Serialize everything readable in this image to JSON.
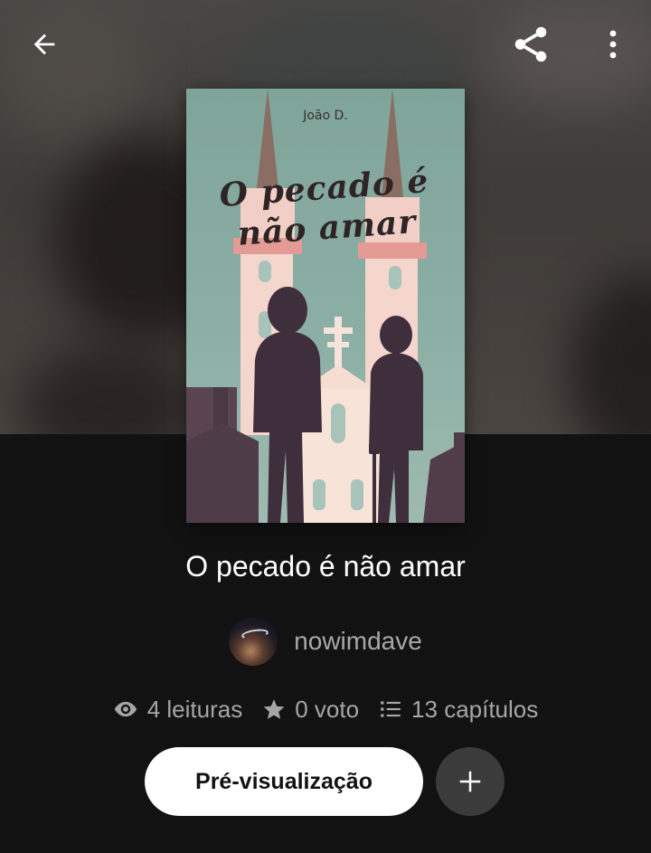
{
  "header": {
    "back_icon": "arrow-left-icon",
    "share_icon": "share-icon",
    "more_icon": "more-vertical-icon"
  },
  "cover": {
    "author_text": "João D.",
    "title_text": "O pecado é não amar"
  },
  "story": {
    "title": "O pecado é não amar",
    "author": "nowimdave",
    "stats": {
      "reads": "4 leituras",
      "votes": "0 voto",
      "chapters": "13 capítulos"
    }
  },
  "actions": {
    "preview_label": "Pré-visualização",
    "add_icon": "plus-icon"
  },
  "colors": {
    "background": "#121212",
    "primary_button": "#ffffff",
    "secondary_button": "#3b3b3b",
    "muted_text": "#a6a6a6"
  }
}
